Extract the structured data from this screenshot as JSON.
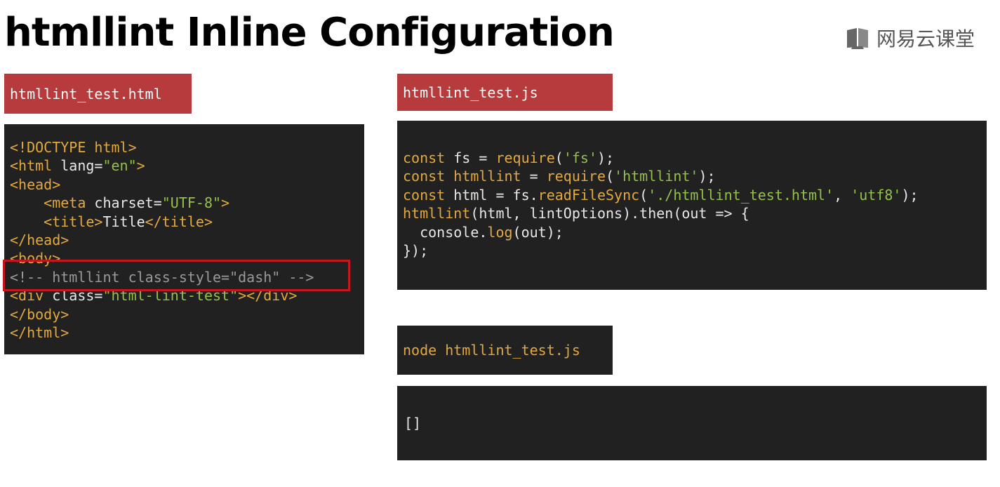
{
  "slide": {
    "title": "htmllint Inline Configuration",
    "brand": "网易云课堂",
    "brand_icon": "book-icon"
  },
  "html_panel": {
    "label": "htmllint_test.html",
    "lines": [
      [
        {
          "t": "<!DOCTYPE html>",
          "c": "tag"
        }
      ],
      [
        {
          "t": "<html ",
          "c": "tag"
        },
        {
          "t": "lang=",
          "c": "plain"
        },
        {
          "t": "\"en\"",
          "c": "str"
        },
        {
          "t": ">",
          "c": "tag"
        }
      ],
      [
        {
          "t": "<head>",
          "c": "tag"
        }
      ],
      [
        {
          "t": "    <meta ",
          "c": "tag"
        },
        {
          "t": "charset=",
          "c": "plain"
        },
        {
          "t": "\"UTF-8\"",
          "c": "str"
        },
        {
          "t": ">",
          "c": "tag"
        }
      ],
      [
        {
          "t": "    <title>",
          "c": "tag"
        },
        {
          "t": "Title",
          "c": "plain"
        },
        {
          "t": "</title>",
          "c": "tag"
        }
      ],
      [
        {
          "t": "</head>",
          "c": "tag"
        }
      ],
      [
        {
          "t": "<body>",
          "c": "tag"
        }
      ],
      [
        {
          "t": "<!-- htmllint class-style=\"dash\" -->",
          "c": "cmt"
        }
      ],
      [
        {
          "t": "<div ",
          "c": "tag"
        },
        {
          "t": "class=",
          "c": "plain"
        },
        {
          "t": "\"html-lint-test\"",
          "c": "str"
        },
        {
          "t": "></div>",
          "c": "tag"
        }
      ],
      [
        {
          "t": "</body>",
          "c": "tag"
        }
      ],
      [
        {
          "t": "</html>",
          "c": "tag"
        }
      ]
    ]
  },
  "js_panel": {
    "label": "htmllint_test.js",
    "lines": [
      [
        {
          "t": "const",
          "c": "kw"
        },
        {
          "t": " fs = ",
          "c": "plain"
        },
        {
          "t": "require",
          "c": "kw"
        },
        {
          "t": "(",
          "c": "plain"
        },
        {
          "t": "'fs'",
          "c": "str"
        },
        {
          "t": ");",
          "c": "plain"
        }
      ],
      [
        {
          "t": "const",
          "c": "kw"
        },
        {
          "t": " htmllint",
          "c": "kw"
        },
        {
          "t": " = ",
          "c": "plain"
        },
        {
          "t": "require",
          "c": "kw"
        },
        {
          "t": "(",
          "c": "plain"
        },
        {
          "t": "'htmllint'",
          "c": "str"
        },
        {
          "t": ");",
          "c": "plain"
        }
      ],
      [
        {
          "t": "const",
          "c": "kw"
        },
        {
          "t": " html = fs.",
          "c": "plain"
        },
        {
          "t": "readFileSync",
          "c": "kw"
        },
        {
          "t": "(",
          "c": "plain"
        },
        {
          "t": "'./htmllint_test.html'",
          "c": "str"
        },
        {
          "t": ", ",
          "c": "plain"
        },
        {
          "t": "'utf8'",
          "c": "str"
        },
        {
          "t": ");",
          "c": "plain"
        }
      ],
      [
        {
          "t": "htmllint",
          "c": "kw"
        },
        {
          "t": "(html, lintOptions).then(out => {",
          "c": "plain"
        }
      ],
      [
        {
          "t": "  console.",
          "c": "plain"
        },
        {
          "t": "log",
          "c": "kw"
        },
        {
          "t": "(out);",
          "c": "plain"
        }
      ],
      [
        {
          "t": "});",
          "c": "plain"
        }
      ]
    ]
  },
  "terminal": {
    "command": "node htmllint_test.js",
    "output": "[]"
  }
}
